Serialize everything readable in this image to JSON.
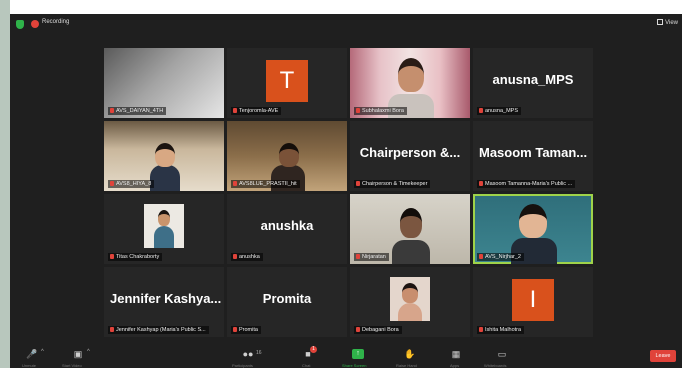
{
  "top_bar": {
    "recording_label": "Recording",
    "view_label": "View"
  },
  "tiles": [
    {
      "name": "AVS_DAIYAN_4TH",
      "type": "video"
    },
    {
      "name": "Tenjoromla-AVE",
      "type": "avatar",
      "avatar_letter": "T",
      "avatar_color": "#d9511c"
    },
    {
      "name": "Subhalaxmi Bora",
      "type": "video"
    },
    {
      "name": "anusna_MPS",
      "type": "name",
      "display_name": "anusna_MPS"
    },
    {
      "name": "AVS8_HIYA_8",
      "type": "video"
    },
    {
      "name": "AVS8LUE_PRASTII_hit",
      "type": "video"
    },
    {
      "name": "Chairperson & Timekeeper",
      "type": "name",
      "display_name": "Chairperson &..."
    },
    {
      "name": "Masoom Tamanna-Maria's Public ...",
      "type": "name",
      "display_name": "Masoom Taman..."
    },
    {
      "name": "Titas Chakraborty",
      "type": "video"
    },
    {
      "name": "anushka",
      "type": "name",
      "display_name": "anushka"
    },
    {
      "name": "Nirjaratan",
      "type": "video"
    },
    {
      "name": "AVS_Nirjhar_2",
      "type": "video",
      "speaking": true
    },
    {
      "name": "Jennifer Kashyap (Maria's Public S...",
      "type": "name",
      "display_name": "Jennifer Kashya..."
    },
    {
      "name": "Promita",
      "type": "name",
      "display_name": "Promita"
    },
    {
      "name": "Debagani Bora",
      "type": "video"
    },
    {
      "name": "Ishita Malhotra",
      "type": "avatar",
      "avatar_letter": "I",
      "avatar_color": "#d9511c"
    }
  ],
  "bottom_bar": {
    "unmute_label": "Unmute",
    "start_video_label": "Start Video",
    "participants_label": "Participants",
    "participants_count": "16",
    "chat_label": "Chat",
    "chat_badge": "1",
    "share_label": "Share Screen",
    "raise_hand_label": "Raise Hand",
    "apps_label": "Apps",
    "whiteboards_label": "Whiteboards",
    "leave_label": "Leave"
  },
  "colors": {
    "accent_green": "#9fd34a",
    "leave_red": "#e0433a",
    "window_bg": "#1f1f1f"
  }
}
